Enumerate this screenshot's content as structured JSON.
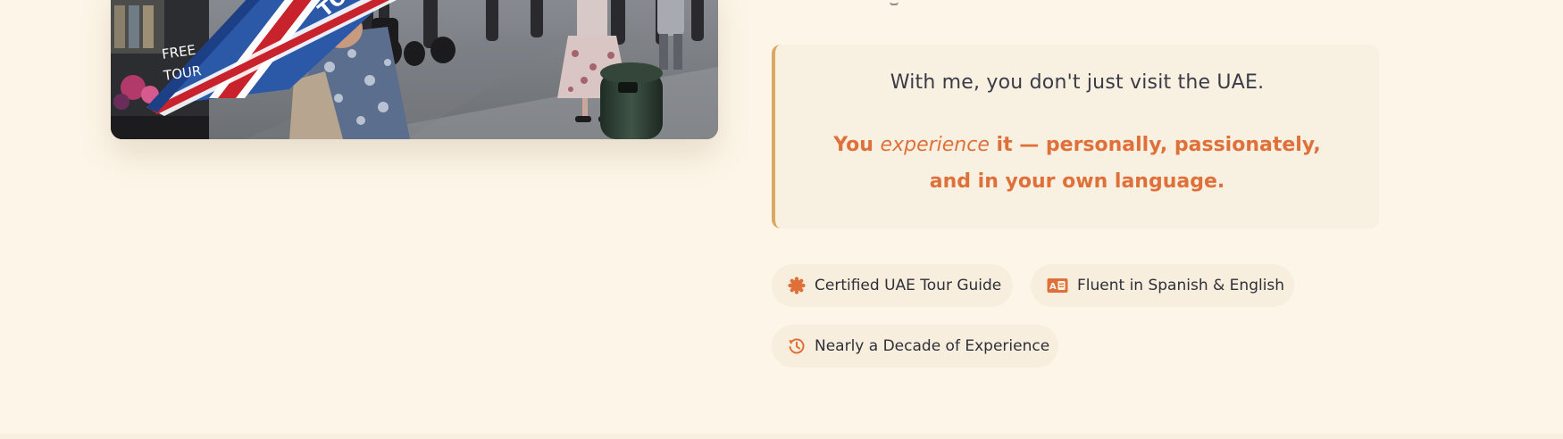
{
  "photo": {
    "alt_icon": "tour-photo-umbrella",
    "umbrella_text_1": "FREE",
    "umbrella_text_2": "TOUR",
    "umbrella_text_3": "TOU",
    "umbrella_text_4": "F"
  },
  "quote": {
    "line1": "With me, you don't just visit the UAE.",
    "line2_prefix": "You ",
    "line2_emphasis": "experience",
    "line2_suffix": " it — personally, passionately, and in your own language."
  },
  "badges": [
    {
      "icon": "certificate-icon",
      "label": "Certified UAE Tour Guide"
    },
    {
      "icon": "language-icon",
      "label": "Fluent in Spanish & English"
    },
    {
      "icon": "history-icon",
      "label": "Nearly a Decade of Experience"
    }
  ],
  "colors": {
    "background": "#fdf6e8",
    "accent": "#e0703a",
    "quote_border": "#d9a862",
    "quote_bg": "#f8f0e1",
    "badge_bg": "#f7eedd",
    "text_dark": "#2f2f3a"
  }
}
